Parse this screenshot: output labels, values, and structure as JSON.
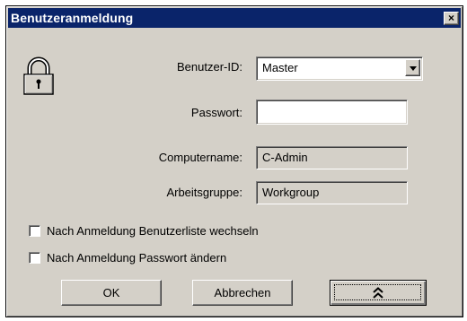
{
  "window": {
    "title": "Benutzeranmeldung",
    "close_label": "×"
  },
  "form": {
    "user_id_label": "Benutzer-ID:",
    "user_id_value": "Master",
    "password_label": "Passwort:",
    "password_value": "",
    "computer_label": "Computername:",
    "computer_value": "C-Admin",
    "workgroup_label": "Arbeitsgruppe:",
    "workgroup_value": "Workgroup"
  },
  "options": {
    "switch_user_list": {
      "label": "Nach Anmeldung Benutzerliste wechseln",
      "checked": false
    },
    "change_password": {
      "label": "Nach Anmeldung Passwort ändern",
      "checked": false
    }
  },
  "buttons": {
    "ok": "OK",
    "cancel": "Abbrechen"
  },
  "icons": {
    "lock": "lock-icon",
    "collapse": "double-chevron-up-icon",
    "dropdown": "chevron-down-icon"
  }
}
